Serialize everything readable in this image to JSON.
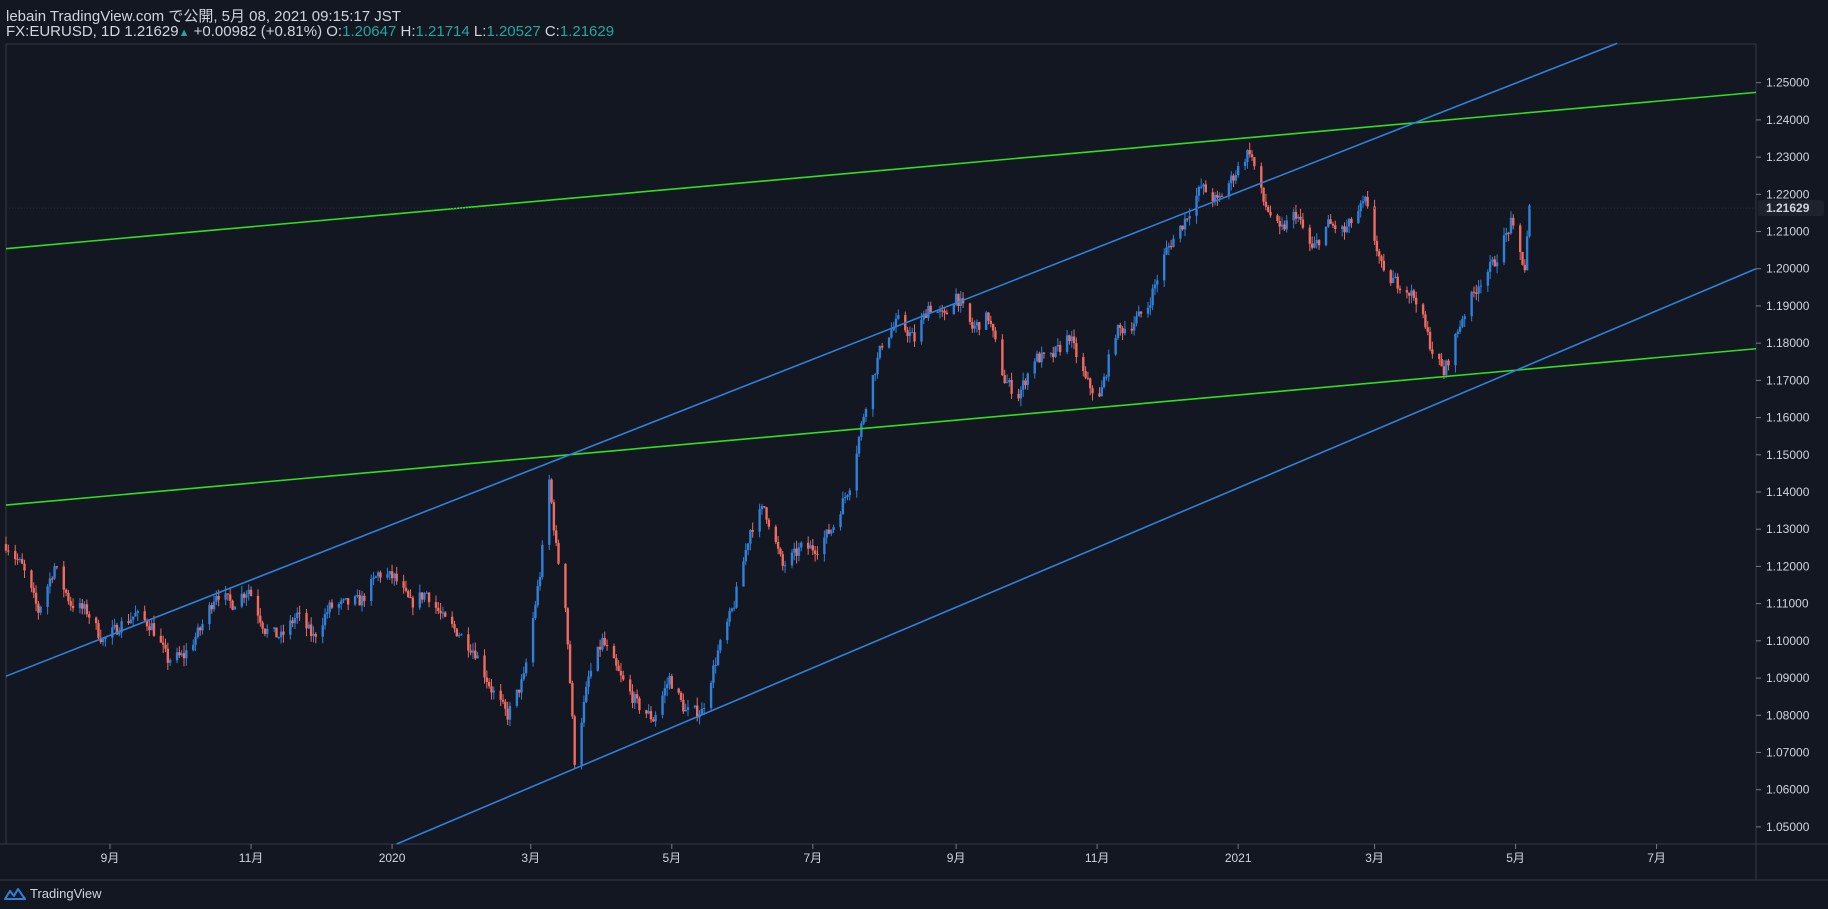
{
  "header": {
    "publisher_line": "lebain TradingView.com で公開, 5月 08, 2021 09:15:17 JST",
    "symbol": "FX:EURUSD, 1D",
    "last": "1.21629",
    "change": "+0.00982 (+0.81%)",
    "o_label": "O:",
    "o_value": "1.20647",
    "h_label": "H:",
    "h_value": "1.21714",
    "l_label": "L:",
    "l_value": "1.20527",
    "c_label": "C:",
    "c_value": "1.21629"
  },
  "footer": {
    "brand": "TradingView"
  },
  "colors": {
    "background": "#131722",
    "up_candle": "#2f80d8",
    "down_candle": "#ef6a5f",
    "channel_line": "#2f80d8",
    "trend_line": "#2fe020",
    "last_price_tag": "#ffffff"
  },
  "chart_data": {
    "type": "candlestick",
    "symbol": "FX:EURUSD",
    "interval": "1D",
    "last_price_label": "1.21629",
    "y_ticks": [
      "1.25000",
      "1.24000",
      "1.23000",
      "1.22000",
      "1.21000",
      "1.20000",
      "1.19000",
      "1.18000",
      "1.17000",
      "1.16000",
      "1.15000",
      "1.14000",
      "1.13000",
      "1.12000",
      "1.11000",
      "1.10000",
      "1.09000",
      "1.08000",
      "1.07000",
      "1.06000",
      "1.05000"
    ],
    "ylim": [
      1.0454,
      1.2604
    ],
    "x_ticks": [
      {
        "label": "9月",
        "date": "2019-09-01"
      },
      {
        "label": "11月",
        "date": "2019-11-01"
      },
      {
        "label": "2020",
        "date": "2020-01-01"
      },
      {
        "label": "3月",
        "date": "2020-03-01"
      },
      {
        "label": "5月",
        "date": "2020-05-01"
      },
      {
        "label": "7月",
        "date": "2020-07-01"
      },
      {
        "label": "9月",
        "date": "2020-09-01"
      },
      {
        "label": "11月",
        "date": "2020-11-01"
      },
      {
        "label": "2021",
        "date": "2021-01-01"
      },
      {
        "label": "3月",
        "date": "2021-03-01"
      },
      {
        "label": "5月",
        "date": "2021-05-01"
      },
      {
        "label": "7月",
        "date": "2021-07-01"
      }
    ],
    "xlim": [
      "2019-07-18",
      "2021-08-13"
    ],
    "price_path": [
      [
        "2019-07-18",
        1.126
      ],
      [
        "2019-07-25",
        1.12
      ],
      [
        "2019-08-01",
        1.108
      ],
      [
        "2019-08-08",
        1.12
      ],
      [
        "2019-08-15",
        1.11
      ],
      [
        "2019-08-22",
        1.108
      ],
      [
        "2019-08-29",
        1.1
      ],
      [
        "2019-09-05",
        1.104
      ],
      [
        "2019-09-12",
        1.107
      ],
      [
        "2019-09-19",
        1.104
      ],
      [
        "2019-09-26",
        1.095
      ],
      [
        "2019-10-03",
        1.096
      ],
      [
        "2019-10-10",
        1.103
      ],
      [
        "2019-10-17",
        1.113
      ],
      [
        "2019-10-24",
        1.11
      ],
      [
        "2019-10-31",
        1.114
      ],
      [
        "2019-11-07",
        1.103
      ],
      [
        "2019-11-14",
        1.101
      ],
      [
        "2019-11-21",
        1.107
      ],
      [
        "2019-11-28",
        1.101
      ],
      [
        "2019-12-05",
        1.109
      ],
      [
        "2019-12-12",
        1.11
      ],
      [
        "2019-12-19",
        1.111
      ],
      [
        "2019-12-26",
        1.118
      ],
      [
        "2020-01-02",
        1.117
      ],
      [
        "2020-01-09",
        1.11
      ],
      [
        "2020-01-16",
        1.113
      ],
      [
        "2020-01-23",
        1.106
      ],
      [
        "2020-01-30",
        1.102
      ],
      [
        "2020-02-06",
        1.097
      ],
      [
        "2020-02-13",
        1.087
      ],
      [
        "2020-02-20",
        1.08
      ],
      [
        "2020-02-27",
        1.09
      ],
      [
        "2020-03-05",
        1.118
      ],
      [
        "2020-03-09",
        1.143
      ],
      [
        "2020-03-12",
        1.125
      ],
      [
        "2020-03-16",
        1.11
      ],
      [
        "2020-03-20",
        1.068
      ],
      [
        "2020-03-26",
        1.09
      ],
      [
        "2020-04-01",
        1.1
      ],
      [
        "2020-04-09",
        1.09
      ],
      [
        "2020-04-16",
        1.083
      ],
      [
        "2020-04-23",
        1.079
      ],
      [
        "2020-04-30",
        1.09
      ],
      [
        "2020-05-07",
        1.081
      ],
      [
        "2020-05-14",
        1.081
      ],
      [
        "2020-05-21",
        1.097
      ],
      [
        "2020-05-28",
        1.11
      ],
      [
        "2020-06-04",
        1.13
      ],
      [
        "2020-06-10",
        1.136
      ],
      [
        "2020-06-18",
        1.12
      ],
      [
        "2020-06-26",
        1.125
      ],
      [
        "2020-07-03",
        1.125
      ],
      [
        "2020-07-10",
        1.131
      ],
      [
        "2020-07-17",
        1.142
      ],
      [
        "2020-07-24",
        1.164
      ],
      [
        "2020-07-31",
        1.18
      ],
      [
        "2020-08-07",
        1.186
      ],
      [
        "2020-08-14",
        1.181
      ],
      [
        "2020-08-20",
        1.19
      ],
      [
        "2020-08-27",
        1.187
      ],
      [
        "2020-09-01",
        1.193
      ],
      [
        "2020-09-08",
        1.184
      ],
      [
        "2020-09-15",
        1.187
      ],
      [
        "2020-09-22",
        1.17
      ],
      [
        "2020-09-28",
        1.166
      ],
      [
        "2020-10-05",
        1.176
      ],
      [
        "2020-10-12",
        1.176
      ],
      [
        "2020-10-20",
        1.182
      ],
      [
        "2020-10-27",
        1.17
      ],
      [
        "2020-11-02",
        1.165
      ],
      [
        "2020-11-09",
        1.183
      ],
      [
        "2020-11-16",
        1.185
      ],
      [
        "2020-11-23",
        1.19
      ],
      [
        "2020-12-01",
        1.205
      ],
      [
        "2020-12-08",
        1.212
      ],
      [
        "2020-12-16",
        1.222
      ],
      [
        "2020-12-23",
        1.218
      ],
      [
        "2021-01-06",
        1.232
      ],
      [
        "2021-01-12",
        1.218
      ],
      [
        "2021-01-19",
        1.21
      ],
      [
        "2021-01-26",
        1.215
      ],
      [
        "2021-02-02",
        1.205
      ],
      [
        "2021-02-09",
        1.212
      ],
      [
        "2021-02-16",
        1.21
      ],
      [
        "2021-02-25",
        1.218
      ],
      [
        "2021-03-05",
        1.198
      ],
      [
        "2021-03-12",
        1.196
      ],
      [
        "2021-03-19",
        1.192
      ],
      [
        "2021-03-26",
        1.178
      ],
      [
        "2021-03-31",
        1.172
      ],
      [
        "2021-04-08",
        1.187
      ],
      [
        "2021-04-15",
        1.196
      ],
      [
        "2021-04-22",
        1.202
      ],
      [
        "2021-04-29",
        1.212
      ],
      [
        "2021-05-05",
        1.2
      ],
      [
        "2021-05-07",
        1.216
      ]
    ],
    "trend_lines": [
      {
        "name": "upper-green-line",
        "color": "#2fe020",
        "from": [
          "2019-07-18",
          1.2054
        ],
        "to": [
          "2021-08-13",
          1.2474
        ]
      },
      {
        "name": "lower-green-line",
        "color": "#2fe020",
        "from": [
          "2019-07-18",
          1.1365
        ],
        "to": [
          "2021-08-13",
          1.1785
        ]
      },
      {
        "name": "upper-blue-channel",
        "color": "#2f80d8",
        "from": [
          "2019-07-18",
          1.0905
        ],
        "to": [
          "2021-06-14",
          1.2606
        ]
      },
      {
        "name": "lower-blue-channel",
        "color": "#2f80d8",
        "from": [
          "2020-01-03",
          1.0454
        ],
        "to": [
          "2021-08-13",
          1.2
        ]
      }
    ]
  }
}
